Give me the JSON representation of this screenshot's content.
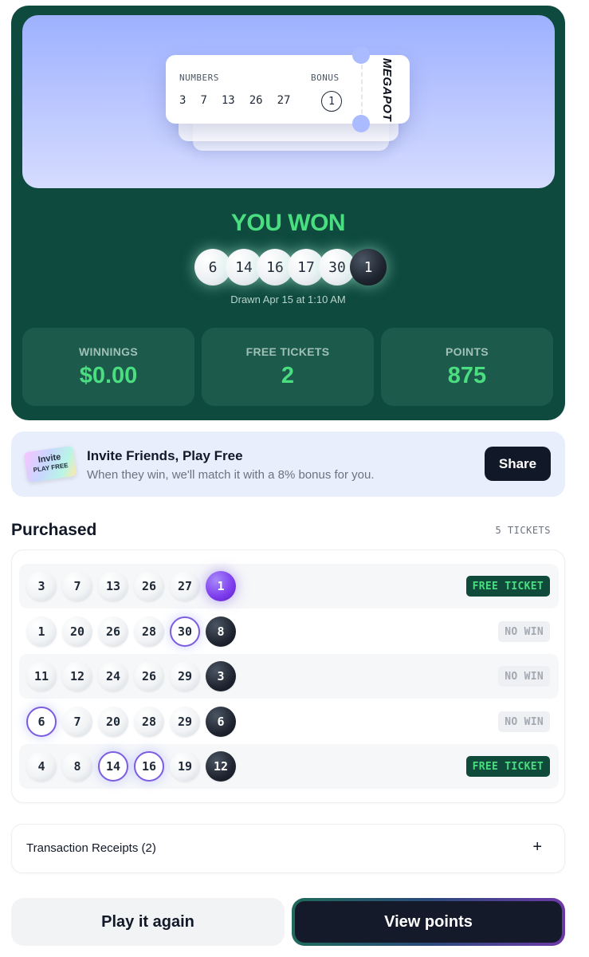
{
  "ticket_preview": {
    "numbers_label": "NUMBERS",
    "bonus_label": "BONUS",
    "numbers": [
      "3",
      "7",
      "13",
      "26",
      "27"
    ],
    "bonus": "1",
    "brand": "MEGAPOT"
  },
  "result": {
    "title": "YOU WON",
    "drawn_numbers": [
      "6",
      "14",
      "16",
      "17",
      "30"
    ],
    "drawn_bonus": "1",
    "drawn_at": "Drawn Apr 15 at 1:10 AM"
  },
  "stats": [
    {
      "label": "WINNINGS",
      "value": "$0.00"
    },
    {
      "label": "FREE TICKETS",
      "value": "2"
    },
    {
      "label": "POINTS",
      "value": "875"
    }
  ],
  "invite": {
    "art_line1": "Invite",
    "art_line2": "PLAY FREE",
    "title": "Invite Friends, Play Free",
    "subtitle": "When they win, we'll match it with a 8% bonus for you.",
    "share_label": "Share"
  },
  "purchased": {
    "title": "Purchased",
    "count_label": "5 TICKETS",
    "tickets": [
      {
        "numbers": [
          "3",
          "7",
          "13",
          "26",
          "27"
        ],
        "bonus": "1",
        "result": "FREE TICKET"
      },
      {
        "numbers": [
          "1",
          "20",
          "26",
          "28",
          "30"
        ],
        "bonus": "8",
        "result": "NO WIN"
      },
      {
        "numbers": [
          "11",
          "12",
          "24",
          "26",
          "29"
        ],
        "bonus": "3",
        "result": "NO WIN"
      },
      {
        "numbers": [
          "6",
          "7",
          "20",
          "28",
          "29"
        ],
        "bonus": "6",
        "result": "NO WIN"
      },
      {
        "numbers": [
          "4",
          "8",
          "14",
          "16",
          "19"
        ],
        "bonus": "12",
        "result": "FREE TICKET"
      }
    ]
  },
  "receipts": {
    "label": "Transaction Receipts (2)",
    "toggle": "+"
  },
  "actions": {
    "play_again": "Play it again",
    "view_points": "View points"
  },
  "colors": {
    "hero_bg": "#0e4a3e",
    "accent_green": "#4ade80",
    "match_purple": "#7c5ce0",
    "dark_button": "#111827"
  }
}
